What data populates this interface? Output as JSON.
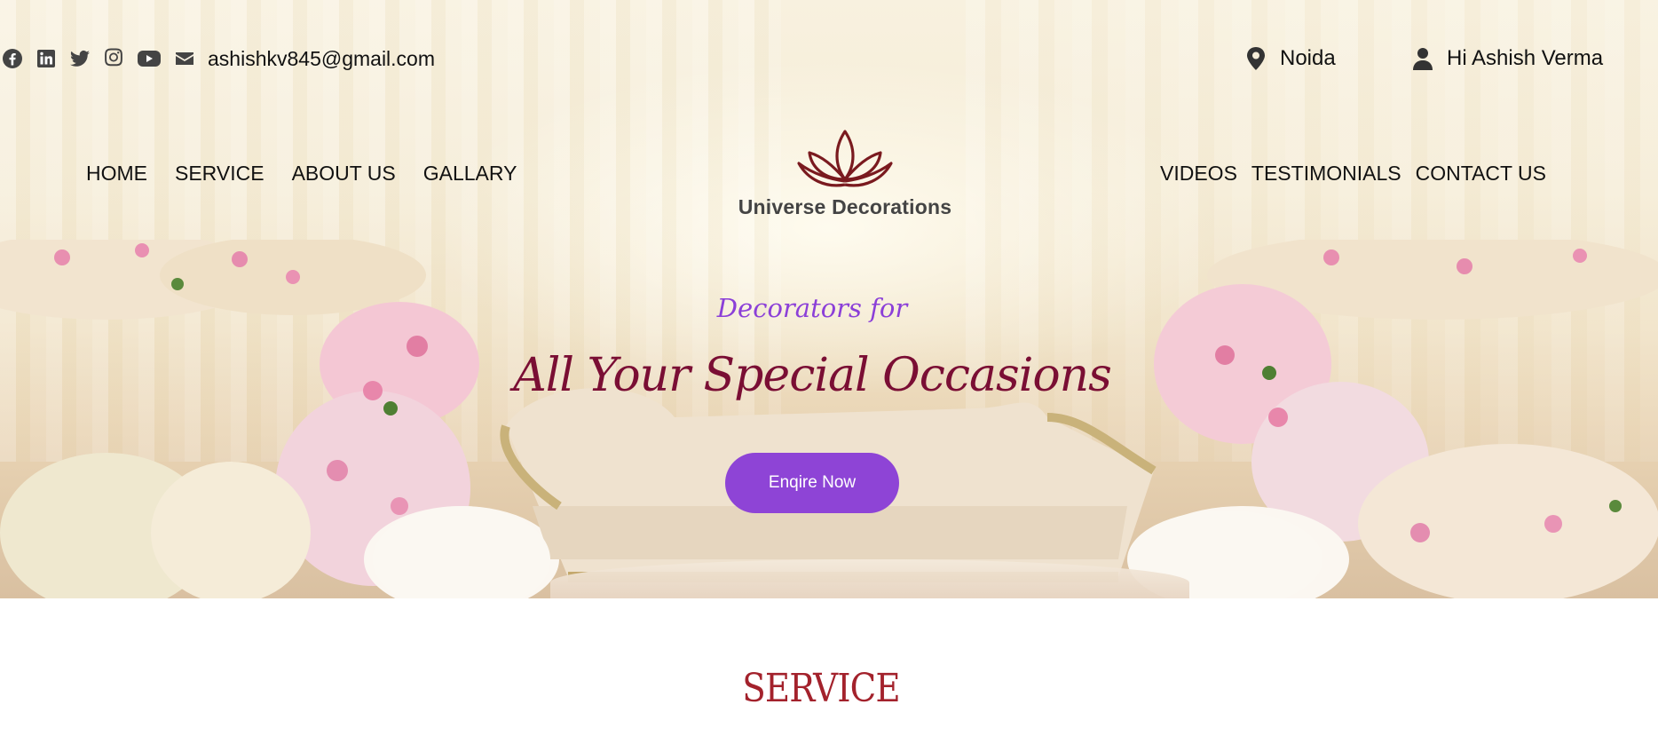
{
  "topbar": {
    "social_icons": [
      "facebook-icon",
      "linkedin-icon",
      "twitter-icon",
      "instagram-icon",
      "youtube-icon"
    ],
    "email_icon": "envelope-icon",
    "email": "ashishkv845@gmail.com",
    "location_icon": "map-pin-icon",
    "location": "Noida",
    "user_icon": "user-icon",
    "greeting": "Hi Ashish Verma"
  },
  "nav": {
    "left": [
      "HOME",
      "SERVICE",
      "ABOUT US",
      "GALLARY"
    ],
    "right": [
      "VIDEOS",
      "TESTIMONIALS",
      "CONTACT US"
    ]
  },
  "logo": {
    "icon": "lotus-icon",
    "text": "Universe Decorations",
    "color": "#7a1a1f"
  },
  "hero": {
    "tagline_small": "Decorators for",
    "tagline_big": "All Your Special Occasions",
    "cta_label": "Enqire Now",
    "colors": {
      "tagline_small": "#8b3fd8",
      "tagline_big": "#7a0e34",
      "cta_background": "#8e44d6"
    }
  },
  "section": {
    "title": "SERVICE",
    "title_color": "#a3222c"
  }
}
